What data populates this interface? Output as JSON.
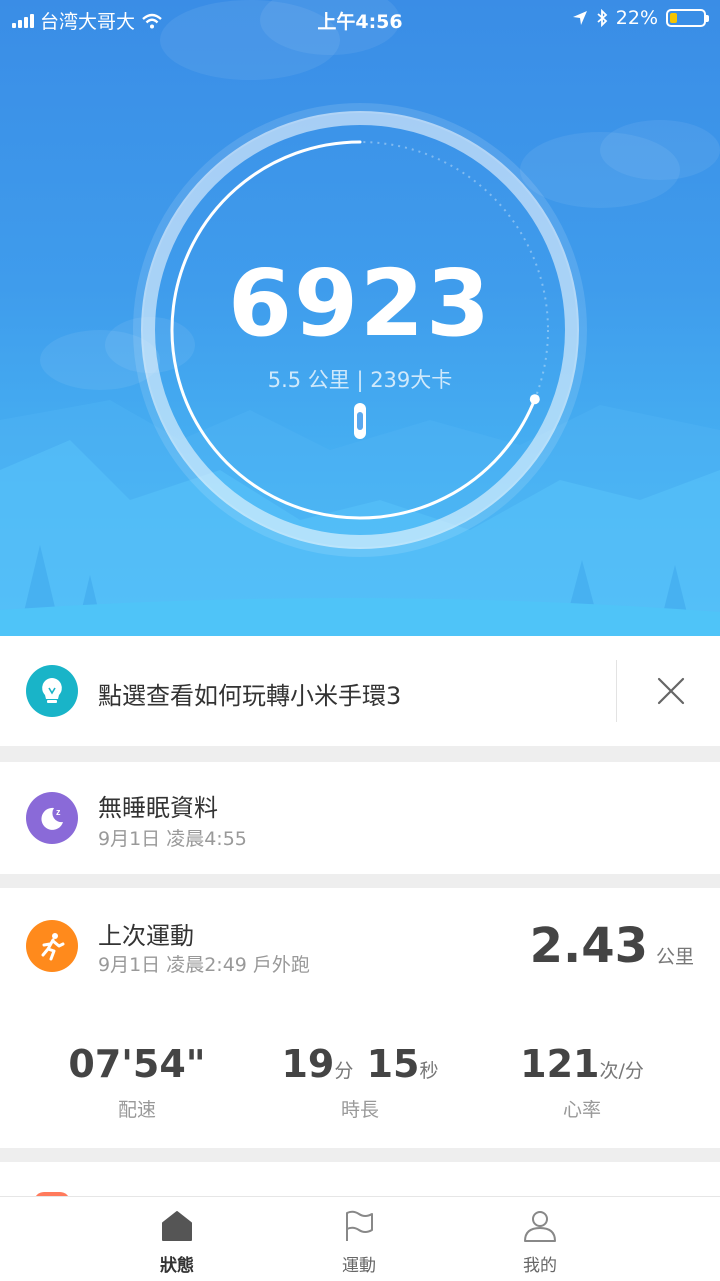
{
  "status_bar": {
    "carrier": "台湾大哥大",
    "time": "上午4:56",
    "battery_percent": "22%",
    "battery_level": 0.22
  },
  "hero": {
    "steps": "6923",
    "distance_calories": "5.5 公里 | 239大卡",
    "progress_fraction": 0.69
  },
  "tip_card": {
    "text": "點選查看如何玩轉小米手環3",
    "icon": "lightbulb-icon",
    "color": "#19b4c8"
  },
  "sleep_card": {
    "title": "無睡眠資料",
    "subtitle": "9月1日 凌晨4:55",
    "icon": "moon-icon",
    "color": "#8a6ad8"
  },
  "workout_card": {
    "title": "上次運動",
    "subtitle": "9月1日 凌晨2:49 戶外跑",
    "icon": "runner-icon",
    "color": "#ff8a1c",
    "distance_value": "2.43",
    "distance_unit": "公里",
    "metrics": [
      {
        "value": "07'54\"",
        "unit": "",
        "label": "配速"
      },
      {
        "value": "19",
        "unit": "分",
        "value2": "15",
        "unit2": "秒",
        "label": "時長"
      },
      {
        "value": "121",
        "unit": "次/分",
        "label": "心率"
      }
    ]
  },
  "tabbar": {
    "tabs": [
      {
        "label": "狀態",
        "icon": "home-icon",
        "active": true
      },
      {
        "label": "運動",
        "icon": "flag-icon",
        "active": false
      },
      {
        "label": "我的",
        "icon": "person-icon",
        "active": false
      }
    ]
  },
  "colors": {
    "accent_blue": "#3f9cec",
    "text_dark": "#333333",
    "text_muted": "#999999"
  }
}
